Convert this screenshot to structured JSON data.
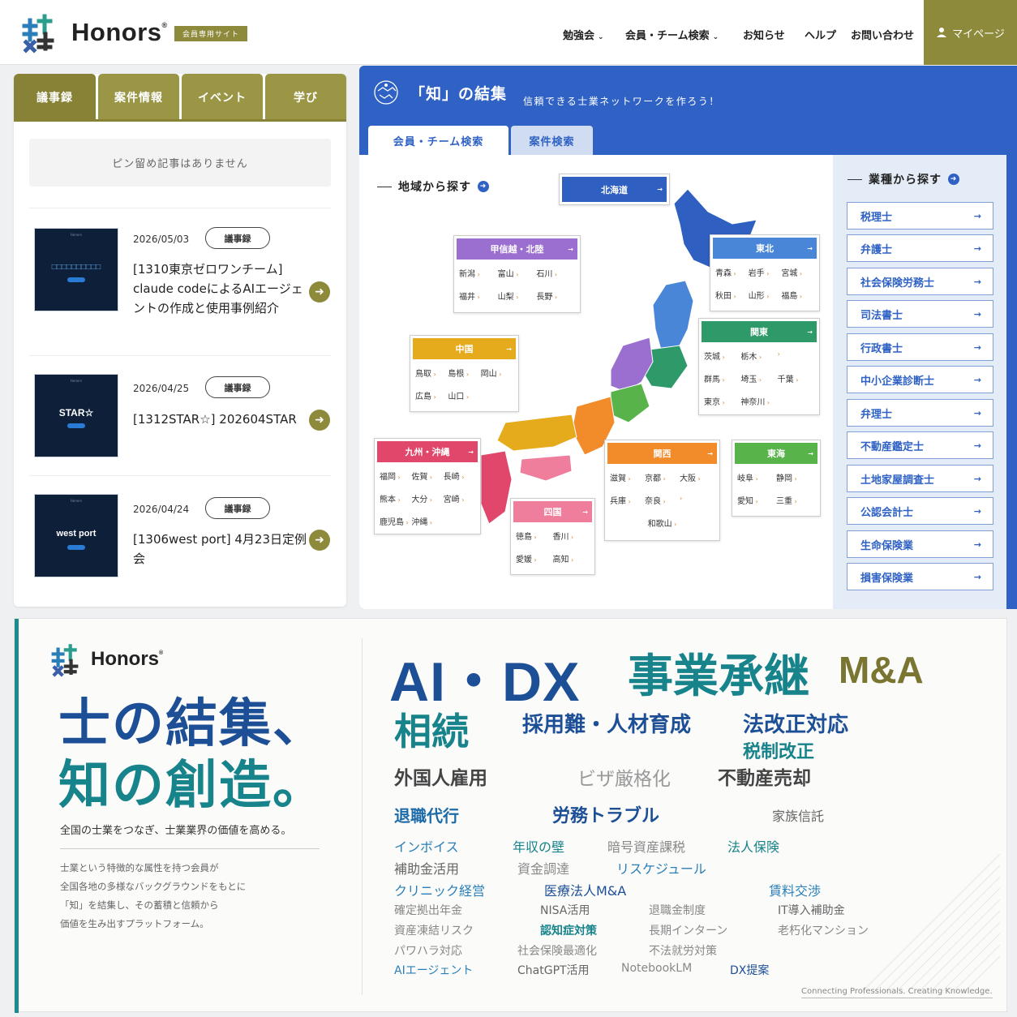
{
  "header": {
    "logo": "Honors",
    "logo_mark": "®",
    "member_badge": "会員専用サイト",
    "nav": [
      {
        "label": "勉強会",
        "dropdown": true
      },
      {
        "label": "会員・チーム検索",
        "dropdown": true
      },
      {
        "label": "お知らせ",
        "dropdown": false
      },
      {
        "label": "ヘルプ",
        "dropdown": false
      },
      {
        "label": "お問い合わせ",
        "dropdown": false
      }
    ],
    "mypage": "マイページ",
    "mypage_icon": "user-icon"
  },
  "left_panel": {
    "tabs": [
      "議事録",
      "案件情報",
      "イベント",
      "学び"
    ],
    "pinned_empty": "ピン留め記事はありません",
    "articles": [
      {
        "date": "2026/05/03",
        "tag": "議事録",
        "title": "[1310東京ゼロワンチーム] claude codeによるAIエージェントの作成と使用事例紹介",
        "thumb_text": "□□□□□□□□□□",
        "thumb_header": "Honors"
      },
      {
        "date": "2026/04/25",
        "tag": "議事録",
        "title": "[1312STAR☆] 202604STAR",
        "thumb_text": "STAR☆",
        "thumb_header": "Honors"
      },
      {
        "date": "2026/04/24",
        "tag": "議事録",
        "title": "[1306west port] 4月23日定例会",
        "thumb_text": "west port",
        "thumb_header": "Honors"
      }
    ]
  },
  "search_panel": {
    "title": "「知」の結集",
    "subtitle": "信頼できる士業ネットワークを作ろう！",
    "tabs": [
      "会員・チーム検索",
      "案件検索"
    ],
    "region_heading": "地域から探す",
    "industry_heading": "業種から探す",
    "regions": {
      "hokkaido": {
        "name": "北海道",
        "prefs": []
      },
      "tohoku": {
        "name": "東北",
        "prefs": [
          "青森",
          "岩手",
          "宮城",
          "秋田",
          "山形",
          "福島"
        ]
      },
      "koshinetsu": {
        "name": "甲信越・北陸",
        "prefs": [
          "新潟",
          "富山",
          "石川",
          "福井",
          "山梨",
          "長野"
        ]
      },
      "kanto": {
        "name": "関東",
        "prefs": [
          "茨城",
          "栃木",
          "群馬",
          "埼玉",
          "千葉",
          "東京",
          "神奈川"
        ]
      },
      "chugoku": {
        "name": "中国",
        "prefs": [
          "鳥取",
          "島根",
          "岡山",
          "広島",
          "山口"
        ]
      },
      "kyushu": {
        "name": "九州・沖縄",
        "prefs": [
          "福岡",
          "佐賀",
          "長崎",
          "熊本",
          "大分",
          "宮崎",
          "鹿児島",
          "沖縄"
        ]
      },
      "kansai": {
        "name": "関西",
        "prefs": [
          "滋賀",
          "京都",
          "大阪",
          "兵庫",
          "奈良",
          "和歌山"
        ]
      },
      "tokai": {
        "name": "東海",
        "prefs": [
          "岐阜",
          "静岡",
          "愛知",
          "三重"
        ]
      },
      "shikoku": {
        "name": "四国",
        "prefs": [
          "徳島",
          "香川",
          "愛媛",
          "高知"
        ]
      }
    },
    "industries": [
      "税理士",
      "弁護士",
      "社会保険労務士",
      "司法書士",
      "行政書士",
      "中小企業診断士",
      "弁理士",
      "不動産鑑定士",
      "土地家屋調査士",
      "公認会計士",
      "生命保険業",
      "損害保険業"
    ],
    "colors": {
      "panel": "#2f62c4",
      "hokkaido": "#2f5fc0",
      "tohoku": "#4a86d8",
      "koshinetsu": "#9b6fd0",
      "kanto": "#2e9a6a",
      "chugoku": "#e5ab1c",
      "kyushu": "#e0476b",
      "kansai": "#f28b2a",
      "tokai": "#57b34a",
      "shikoku": "#ef7d9c"
    }
  },
  "banner": {
    "logo": "Honors",
    "logo_mark": "®",
    "hero_line1": "士の結集、",
    "hero_line2": "知の創造。",
    "tagline": "全国の士業をつなぎ、士業業界の価値を高める。",
    "description": [
      "士業という特徴的な属性を持つ会員が",
      "全国各地の多様なバックグラウンドをもとに",
      "「知」を結集し、その蓄積と信頼から",
      "価値を生み出すプラットフォーム。"
    ],
    "keywords": [
      "AI・DX",
      "事業承継",
      "M&A",
      "相続",
      "採用難・人材育成",
      "法改正対応",
      "税制改正",
      "外国人雇用",
      "ビザ厳格化",
      "不動産売却",
      "退職代行",
      "労務トラブル",
      "家族信託",
      "インボイス",
      "年収の壁",
      "暗号資産課税",
      "法人保険",
      "補助金活用",
      "資金調達",
      "リスケジュール",
      "クリニック経営",
      "医療法人M&A",
      "賃料交渉",
      "確定拠出年金",
      "NISA活用",
      "退職金制度",
      "IT導入補助金",
      "資産凍結リスク",
      "認知症対策",
      "長期インターン",
      "老朽化マンション",
      "パワハラ対応",
      "社会保険最適化",
      "不法就労対策",
      "AIエージェント",
      "ChatGPT活用",
      "NotebookLM",
      "DX提案"
    ],
    "footer": "Connecting Professionals. Creating Knowledge.",
    "colors": {
      "navy": "#1d4f96",
      "teal": "#17838a",
      "olive": "#7a7632",
      "gray": "#888888"
    }
  }
}
